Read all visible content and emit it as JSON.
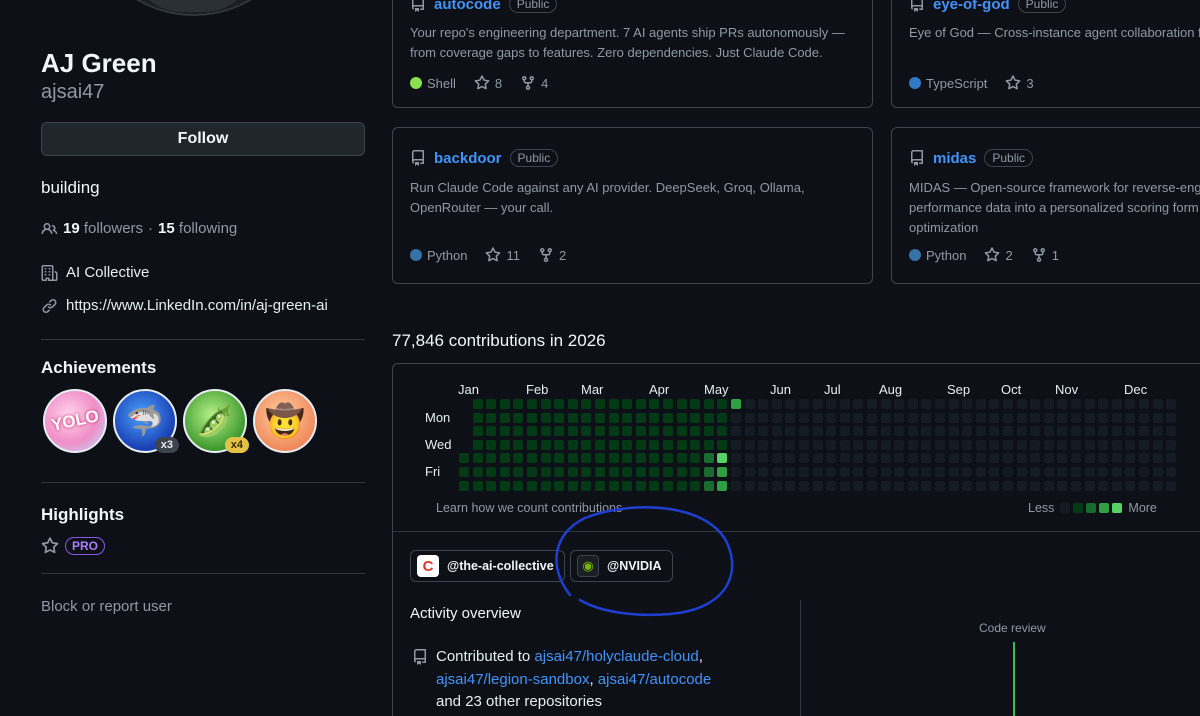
{
  "profile": {
    "name": "AJ Green",
    "login": "ajsai47",
    "follow_label": "Follow",
    "bio": "building",
    "followers_count": "19",
    "followers_label": "followers",
    "separator": "·",
    "following_count": "15",
    "following_label": "following",
    "company": "AI Collective",
    "link": "https://www.LinkedIn.com/in/aj-green-ai"
  },
  "achievements": {
    "title": "Achievements",
    "badges": [
      {
        "name": "yolo",
        "text": "YOLO",
        "count": ""
      },
      {
        "name": "shark",
        "text": "🦈",
        "count": "x3"
      },
      {
        "name": "pair-extraordinaire",
        "text": "🫛",
        "count": "x4"
      },
      {
        "name": "quickdraw",
        "text": "🤠",
        "count": ""
      }
    ]
  },
  "highlights": {
    "title": "Highlights",
    "pro_label": "PRO"
  },
  "block_label": "Block or report user",
  "repos": [
    {
      "name": "autocode",
      "visibility": "Public",
      "desc1": "Your repo's engineering department. 7 AI agents ship PRs autonomously —",
      "desc2": "from coverage gaps to features. Zero dependencies. Just Claude Code.",
      "desc3": "",
      "language": "Shell",
      "lang_color": "#89e051",
      "stars": "8",
      "forks": "4"
    },
    {
      "name": "eye-of-god",
      "visibility": "Public",
      "desc1": "Eye of God — Cross-instance agent collaboration f",
      "desc2": "",
      "desc3": "",
      "language": "TypeScript",
      "lang_color": "#3178c6",
      "stars": "3",
      "forks": ""
    },
    {
      "name": "backdoor",
      "visibility": "Public",
      "desc1": "Run Claude Code against any AI provider. DeepSeek, Groq, Ollama,",
      "desc2": "OpenRouter — your call.",
      "desc3": "",
      "language": "Python",
      "lang_color": "#3572A5",
      "stars": "11",
      "forks": "2"
    },
    {
      "name": "midas",
      "visibility": "Public",
      "desc1": "MIDAS — Open-source framework for reverse-eng",
      "desc2": "performance data into a personalized scoring form",
      "desc3": "optimization",
      "language": "Python",
      "lang_color": "#3572A5",
      "stars": "2",
      "forks": "1"
    }
  ],
  "contributions": {
    "title": "77,846 contributions in 2026",
    "months": [
      "Jan",
      "Feb",
      "Mar",
      "Apr",
      "May",
      "Jun",
      "Jul",
      "Aug",
      "Sep",
      "Oct",
      "Nov",
      "Dec"
    ],
    "day_labels": [
      "Mon",
      "Wed",
      "Fri"
    ],
    "learn_label": "Learn how we count contributions",
    "less_label": "Less",
    "more_label": "More",
    "levels": [
      "#151b23",
      "#033a16",
      "#196c2e",
      "#2ea043",
      "#56d364"
    ]
  },
  "orgs": [
    {
      "label": "@the-ai-collective",
      "logo": "C"
    },
    {
      "label": "@NVIDIA",
      "logo": "◉"
    }
  ],
  "activity": {
    "title": "Activity overview",
    "prefix": "Contributed to",
    "repo1": "ajsai47/holyclaude-cloud",
    "comma1": ",",
    "repo2": "ajsai47/legion-sandbox",
    "comma2": ",",
    "repo3": "ajsai47/autocode",
    "suffix": "and 23 other repositories",
    "code_review_label": "Code review"
  }
}
